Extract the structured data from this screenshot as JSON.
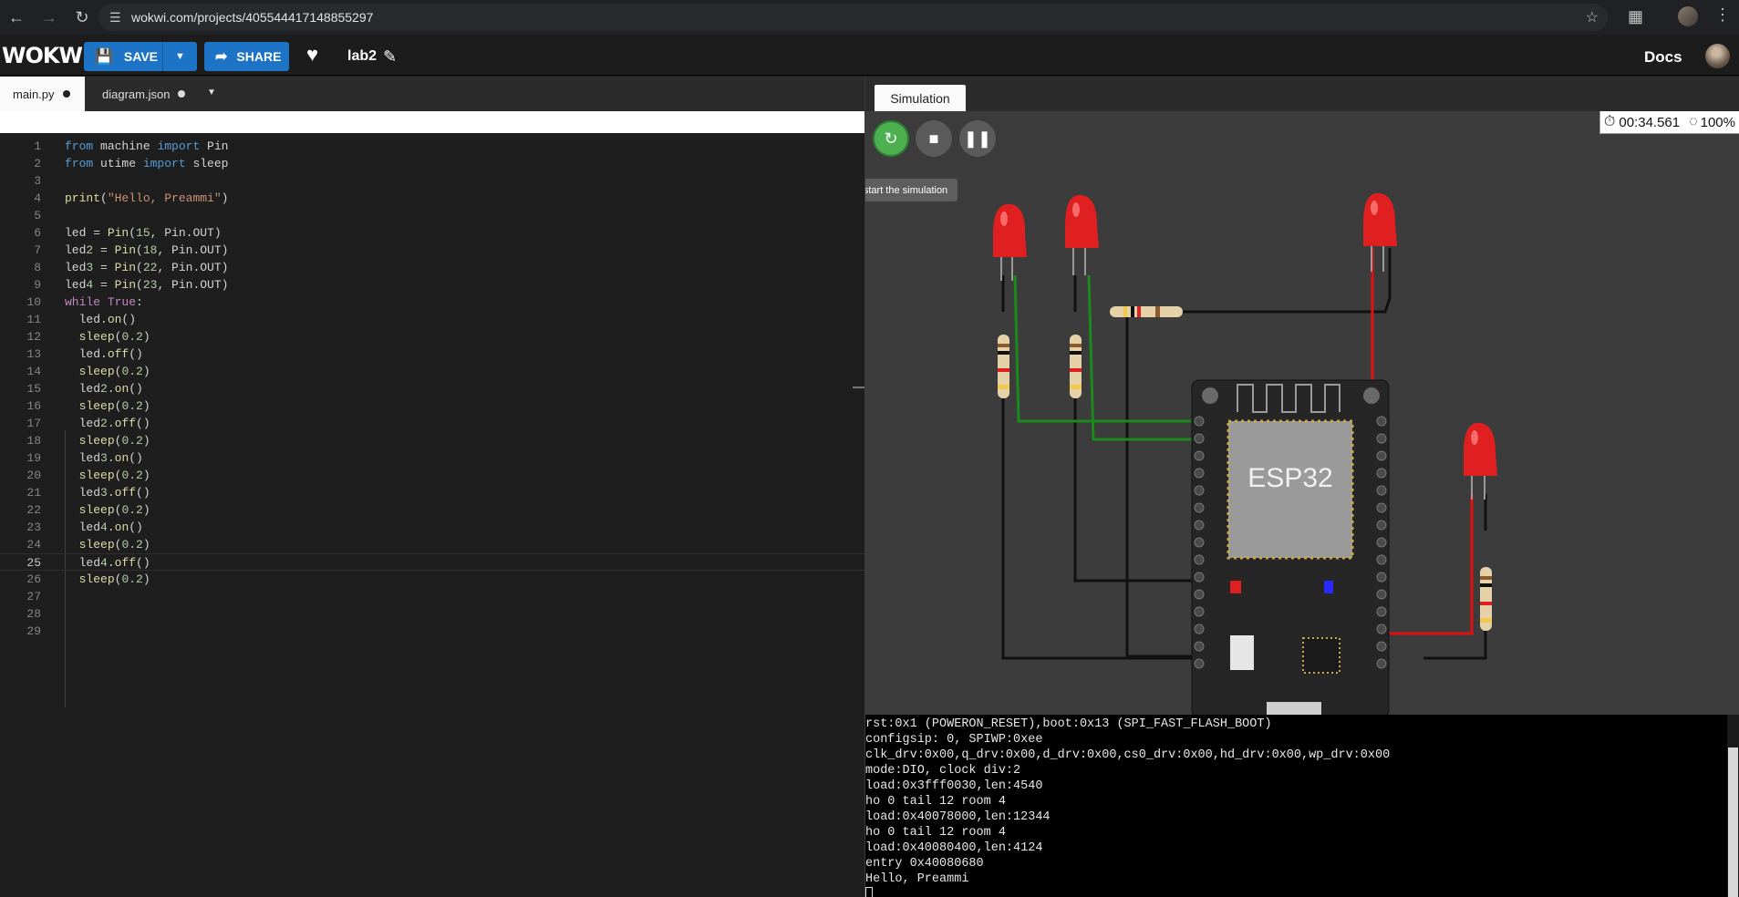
{
  "browser": {
    "url": "wokwi.com/projects/405544417148855297"
  },
  "header": {
    "logo": "WOKWI",
    "save_label": "SAVE",
    "share_label": "SHARE",
    "project_name": "lab2",
    "docs_label": "Docs"
  },
  "editor": {
    "tabs": [
      {
        "label": "main.py",
        "modified": true,
        "active": true
      },
      {
        "label": "diagram.json",
        "modified": true,
        "active": false
      }
    ],
    "current_line": 25,
    "lines": [
      "from machine import Pin",
      "from utime import sleep",
      "",
      "print(\"Hello, Preammi\")",
      "",
      "led = Pin(15, Pin.OUT)",
      "led2 = Pin(18, Pin.OUT)",
      "led3 = Pin(22, Pin.OUT)",
      "led4 = Pin(23, Pin.OUT)",
      "while True:",
      "  led.on()",
      "  sleep(0.2)",
      "  led.off()",
      "  sleep(0.2)",
      "  led2.on()",
      "  sleep(0.2)",
      "  led2.off()",
      "  sleep(0.2)",
      "  led3.on()",
      "  sleep(0.2)",
      "  led3.off()",
      "  sleep(0.2)",
      "  led4.on()",
      "  sleep(0.2)",
      "  led4.off()",
      "  sleep(0.2)",
      "",
      "",
      ""
    ]
  },
  "simulation": {
    "tab_label": "Simulation",
    "restart_tooltip": "Restart the simulation",
    "elapsed_time": "00:34.561",
    "speed": "100%",
    "board_label": "ESP32",
    "colors": {
      "led": "#e02020",
      "wire_green": "#1a8a1a",
      "wire_red": "#e01010",
      "restart": "#4caf50"
    }
  },
  "serial": {
    "lines": [
      "rst:0x1 (POWERON_RESET),boot:0x13 (SPI_FAST_FLASH_BOOT)",
      "configsip: 0, SPIWP:0xee",
      "clk_drv:0x00,q_drv:0x00,d_drv:0x00,cs0_drv:0x00,hd_drv:0x00,wp_drv:0x00",
      "mode:DIO, clock div:2",
      "load:0x3fff0030,len:4540",
      "ho 0 tail 12 room 4",
      "load:0x40078000,len:12344",
      "ho 0 tail 12 room 4",
      "load:0x40080400,len:4124",
      "entry 0x40080680",
      "Hello, Preammi"
    ]
  }
}
